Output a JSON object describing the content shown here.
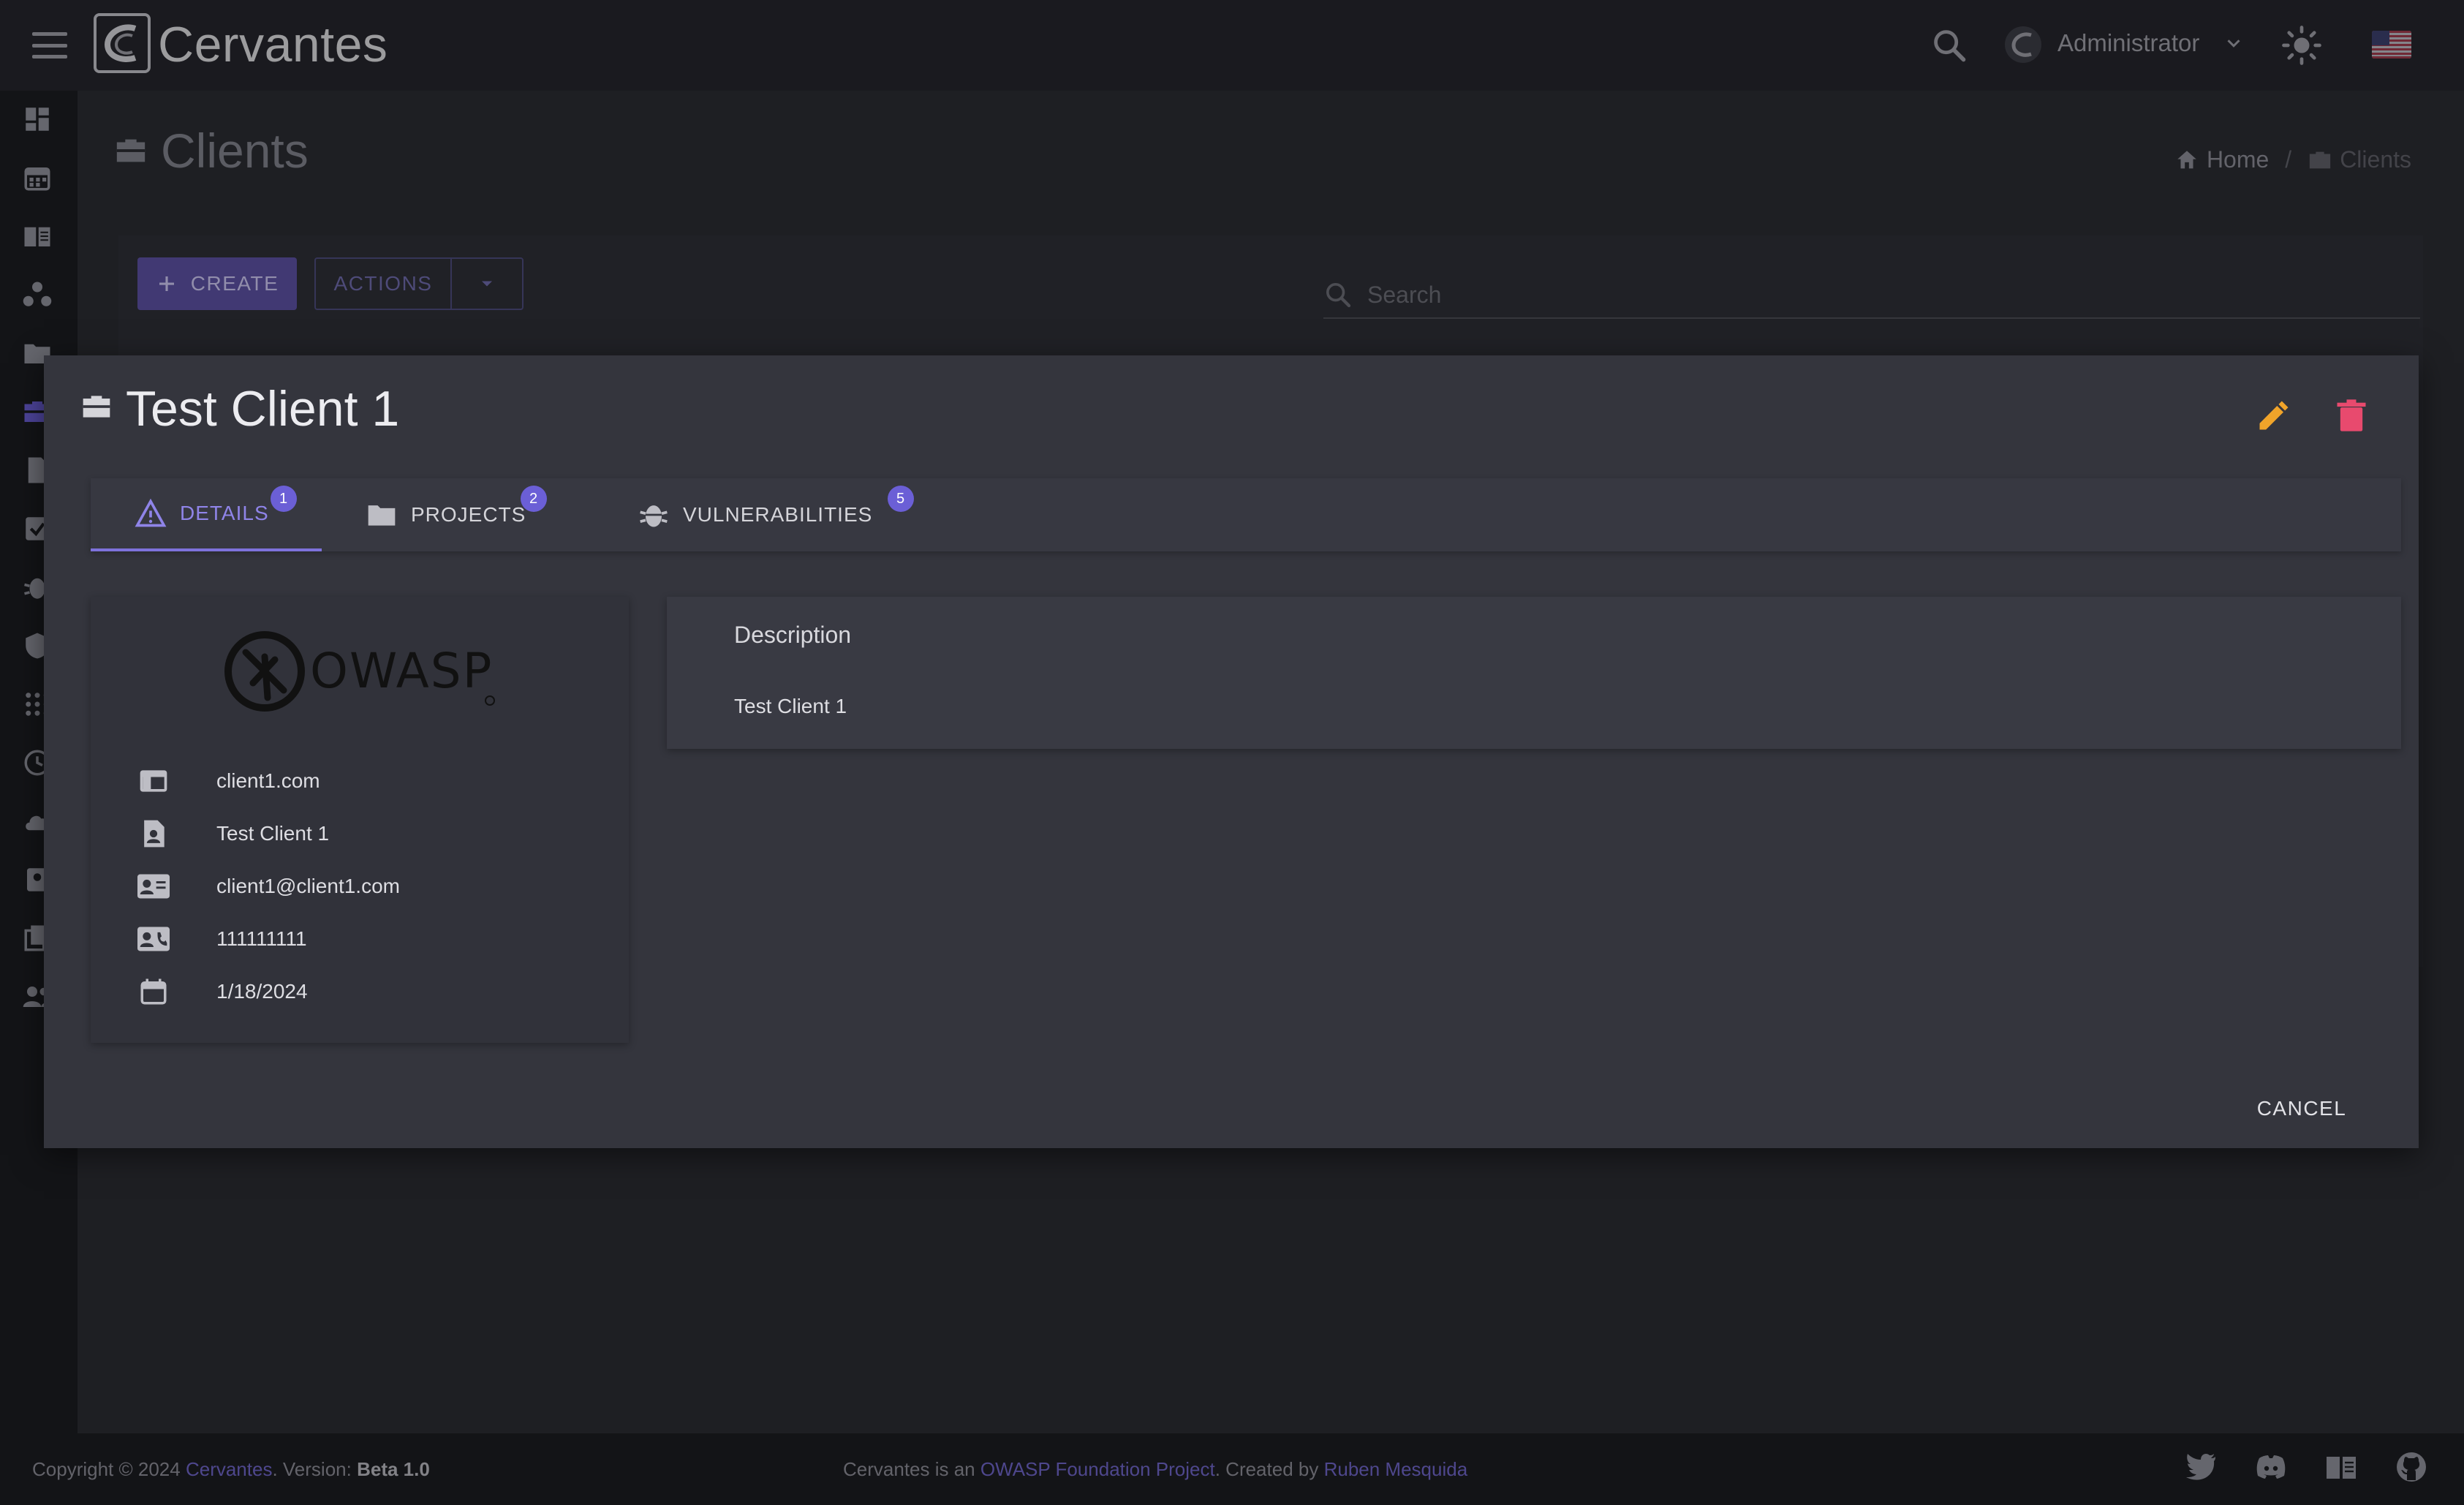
{
  "app": {
    "title": "Cervantes"
  },
  "topbar": {
    "user_name": "Administrator",
    "icons": [
      "menu-icon",
      "search-icon",
      "user-avatar-icon",
      "chevron-down-icon",
      "sun-icon",
      "us-flag-icon"
    ]
  },
  "sidebar": {
    "items": [
      "dashboard-icon",
      "calendar-icon",
      "book-icon",
      "organization-icon",
      "folder-icon",
      "briefcase-icon",
      "document-icon",
      "task-icon",
      "bug-icon",
      "shield-icon",
      "apps-icon",
      "history-icon",
      "cloud-upload-icon",
      "contact-icon",
      "copy-icon",
      "users-icon"
    ],
    "active_item": "briefcase-icon"
  },
  "page": {
    "title": "Clients",
    "breadcrumb": {
      "home": "Home",
      "separator": "/",
      "current": "Clients"
    }
  },
  "toolbar": {
    "create_label": "CREATE",
    "actions_label": "ACTIONS",
    "search_placeholder": "Search"
  },
  "modal": {
    "title": "Test Client 1",
    "tabs": [
      {
        "label": "DETAILS",
        "badge": "1",
        "icon": "warning-icon",
        "active": true
      },
      {
        "label": "PROJECTS",
        "badge": "2",
        "icon": "folder-icon",
        "active": false
      },
      {
        "label": "VULNERABILITIES",
        "badge": "5",
        "icon": "bug-icon",
        "active": false
      }
    ],
    "client": {
      "logo_text": "OWASP",
      "url": "client1.com",
      "contact_name": "Test Client 1",
      "email": "client1@client1.com",
      "phone": "111111111",
      "date": "1/18/2024"
    },
    "description_label": "Description",
    "description": "Test Client 1",
    "cancel_label": "CANCEL"
  },
  "footer": {
    "copyright": "Copyright © 2024",
    "brand_link": "Cervantes",
    "version_prefix": ". Version:",
    "version": "Beta 1.0",
    "middle_prefix": "Cervantes is an",
    "owasp_link": "OWASP Foundation Project",
    "created_by": ". Created by",
    "author_link": "Ruben Mesquida"
  },
  "colors": {
    "accent": "#6b5fd6",
    "edit": "#f0a42a",
    "delete": "#e84a6e"
  }
}
